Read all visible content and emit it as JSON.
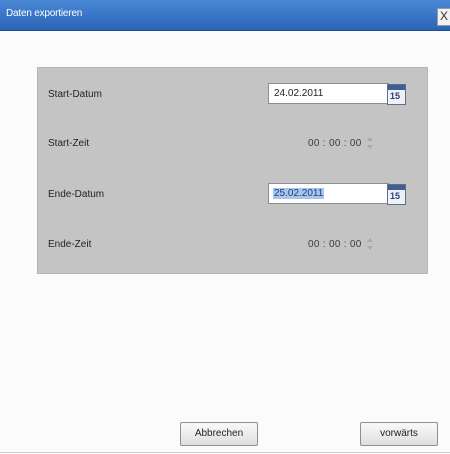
{
  "window": {
    "title": "Daten exportieren",
    "close_glyph": "X"
  },
  "form": {
    "start_date": {
      "label": "Start-Datum",
      "value": "24.02.2011",
      "icon": "calendar-icon",
      "icon_number": "15"
    },
    "start_time": {
      "label": "Start-Zeit",
      "value": "00 : 00 : 00"
    },
    "end_date": {
      "label": "Ende-Datum",
      "value": "25.02.2011",
      "icon": "calendar-icon",
      "icon_number": "15"
    },
    "end_time": {
      "label": "Ende-Zeit",
      "value": "00 : 00 : 00"
    }
  },
  "buttons": {
    "cancel": "Abbrechen",
    "next": "vorwärts"
  }
}
